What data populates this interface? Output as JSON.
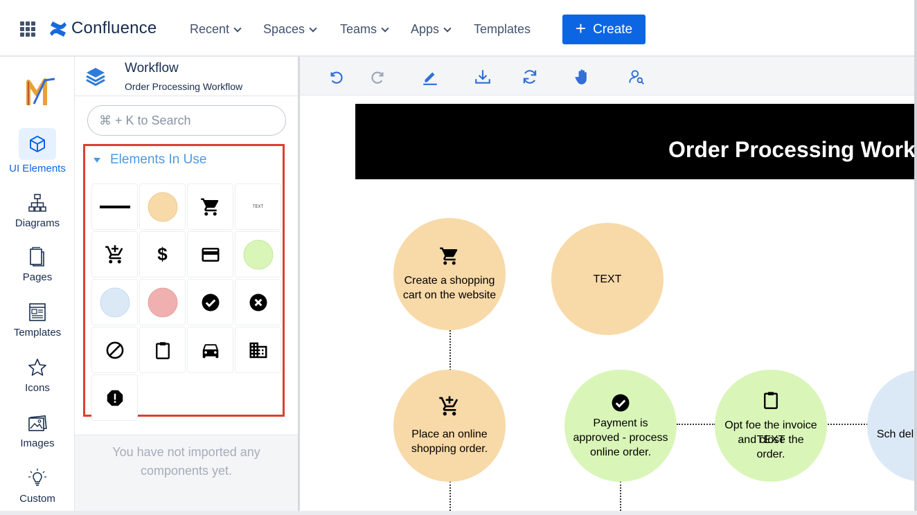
{
  "topbar": {
    "brand": "Confluence",
    "nav": [
      "Recent",
      "Spaces",
      "Teams",
      "Apps",
      "Templates"
    ],
    "create_label": "Create"
  },
  "rail": {
    "items": [
      {
        "label": "UI Elements",
        "icon": "cube-icon"
      },
      {
        "label": "Diagrams",
        "icon": "hierarchy-icon"
      },
      {
        "label": "Pages",
        "icon": "pages-icon"
      },
      {
        "label": "Templates",
        "icon": "template-icon"
      },
      {
        "label": "Icons",
        "icon": "star-icon"
      },
      {
        "label": "Images",
        "icon": "image-icon"
      },
      {
        "label": "Custom",
        "icon": "lightbulb-icon"
      }
    ]
  },
  "panel": {
    "title": "Workflow",
    "subtitle": "Order Processing Workflow",
    "search_placeholder": "⌘ + K to Search",
    "section_title": "Elements In Use",
    "tiles": [
      "line-element",
      "orange-circle",
      "cart-icon",
      "text-element",
      "add-cart-icon",
      "dollar-icon",
      "credit-card-icon",
      "green-circle",
      "blue-circle",
      "red-circle",
      "check-circle-icon",
      "cancel-circle-icon",
      "block-icon",
      "clipboard-icon",
      "car-icon",
      "building-icon",
      "warning-octagon-icon"
    ],
    "tile_text": "TEXT",
    "empty_message": "You have not imported any components yet."
  },
  "canvas": {
    "banner_title": "Order Processing Workflow",
    "nodes": {
      "n1": "Create a shopping cart on the website",
      "n2": "TEXT",
      "n3": "Place an online shopping order.",
      "n4": "Payment is approved - process online order.",
      "n5": "Opt foe the invoice and close the order.",
      "n5_overlay": "TEXT",
      "n6": "Sch deliver shiping"
    }
  },
  "colors": {
    "accent": "#0c66e4",
    "orange_node": "#f8d9a8",
    "green_node": "#d9f5b8",
    "blue_node": "#dbe9f7",
    "red_tile": "#f0b0b0",
    "highlight_border": "#d9412f"
  }
}
